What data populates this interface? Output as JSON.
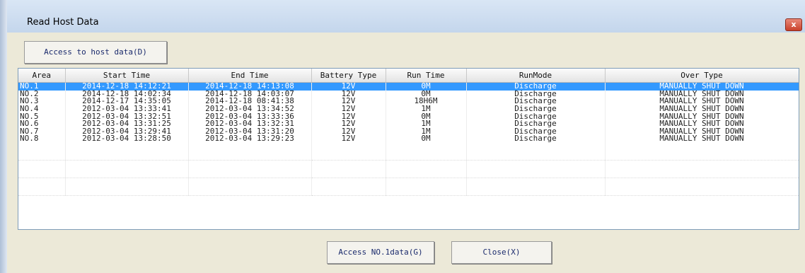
{
  "window": {
    "title": "Read Host Data",
    "close_glyph": "x",
    "close_icon": "close-icon"
  },
  "toolbar": {
    "access_host_label": "Access to host data(D)"
  },
  "table": {
    "columns": [
      "Area",
      "Start Time",
      "End Time",
      "Battery Type",
      "Run Time",
      "RunMode",
      "Over Type"
    ],
    "rows": [
      [
        "NO.1",
        "2014-12-18 14:12:21",
        "2014-12-18 14:13:08",
        "12V",
        "0M",
        "Discharge",
        "MANUALLY SHUT DOWN"
      ],
      [
        "NO.2",
        "2014-12-18 14:02:34",
        "2014-12-18 14:03:07",
        "12V",
        "0M",
        "Discharge",
        "MANUALLY SHUT DOWN"
      ],
      [
        "NO.3",
        "2014-12-17 14:35:05",
        "2014-12-18 08:41:38",
        "12V",
        "18H6M",
        "Discharge",
        "MANUALLY SHUT DOWN"
      ],
      [
        "NO.4",
        "2012-03-04 13:33:41",
        "2012-03-04 13:34:52",
        "12V",
        "1M",
        "Discharge",
        "MANUALLY SHUT DOWN"
      ],
      [
        "NO.5",
        "2012-03-04 13:32:51",
        "2012-03-04 13:33:36",
        "12V",
        "0M",
        "Discharge",
        "MANUALLY SHUT DOWN"
      ],
      [
        "NO.6",
        "2012-03-04 13:31:25",
        "2012-03-04 13:32:31",
        "12V",
        "1M",
        "Discharge",
        "MANUALLY SHUT DOWN"
      ],
      [
        "NO.7",
        "2012-03-04 13:29:41",
        "2012-03-04 13:31:20",
        "12V",
        "1M",
        "Discharge",
        "MANUALLY SHUT DOWN"
      ],
      [
        "NO.8",
        "2012-03-04 13:28:50",
        "2012-03-04 13:29:23",
        "12V",
        "0M",
        "Discharge",
        "MANUALLY SHUT DOWN"
      ]
    ],
    "selected_index": 0
  },
  "footer": {
    "access_no1_label": "Access NO.1data(G)",
    "close_label": "Close(X)"
  },
  "colors": {
    "selection": "#3399ff",
    "dialog_bg": "#ece9d8"
  }
}
